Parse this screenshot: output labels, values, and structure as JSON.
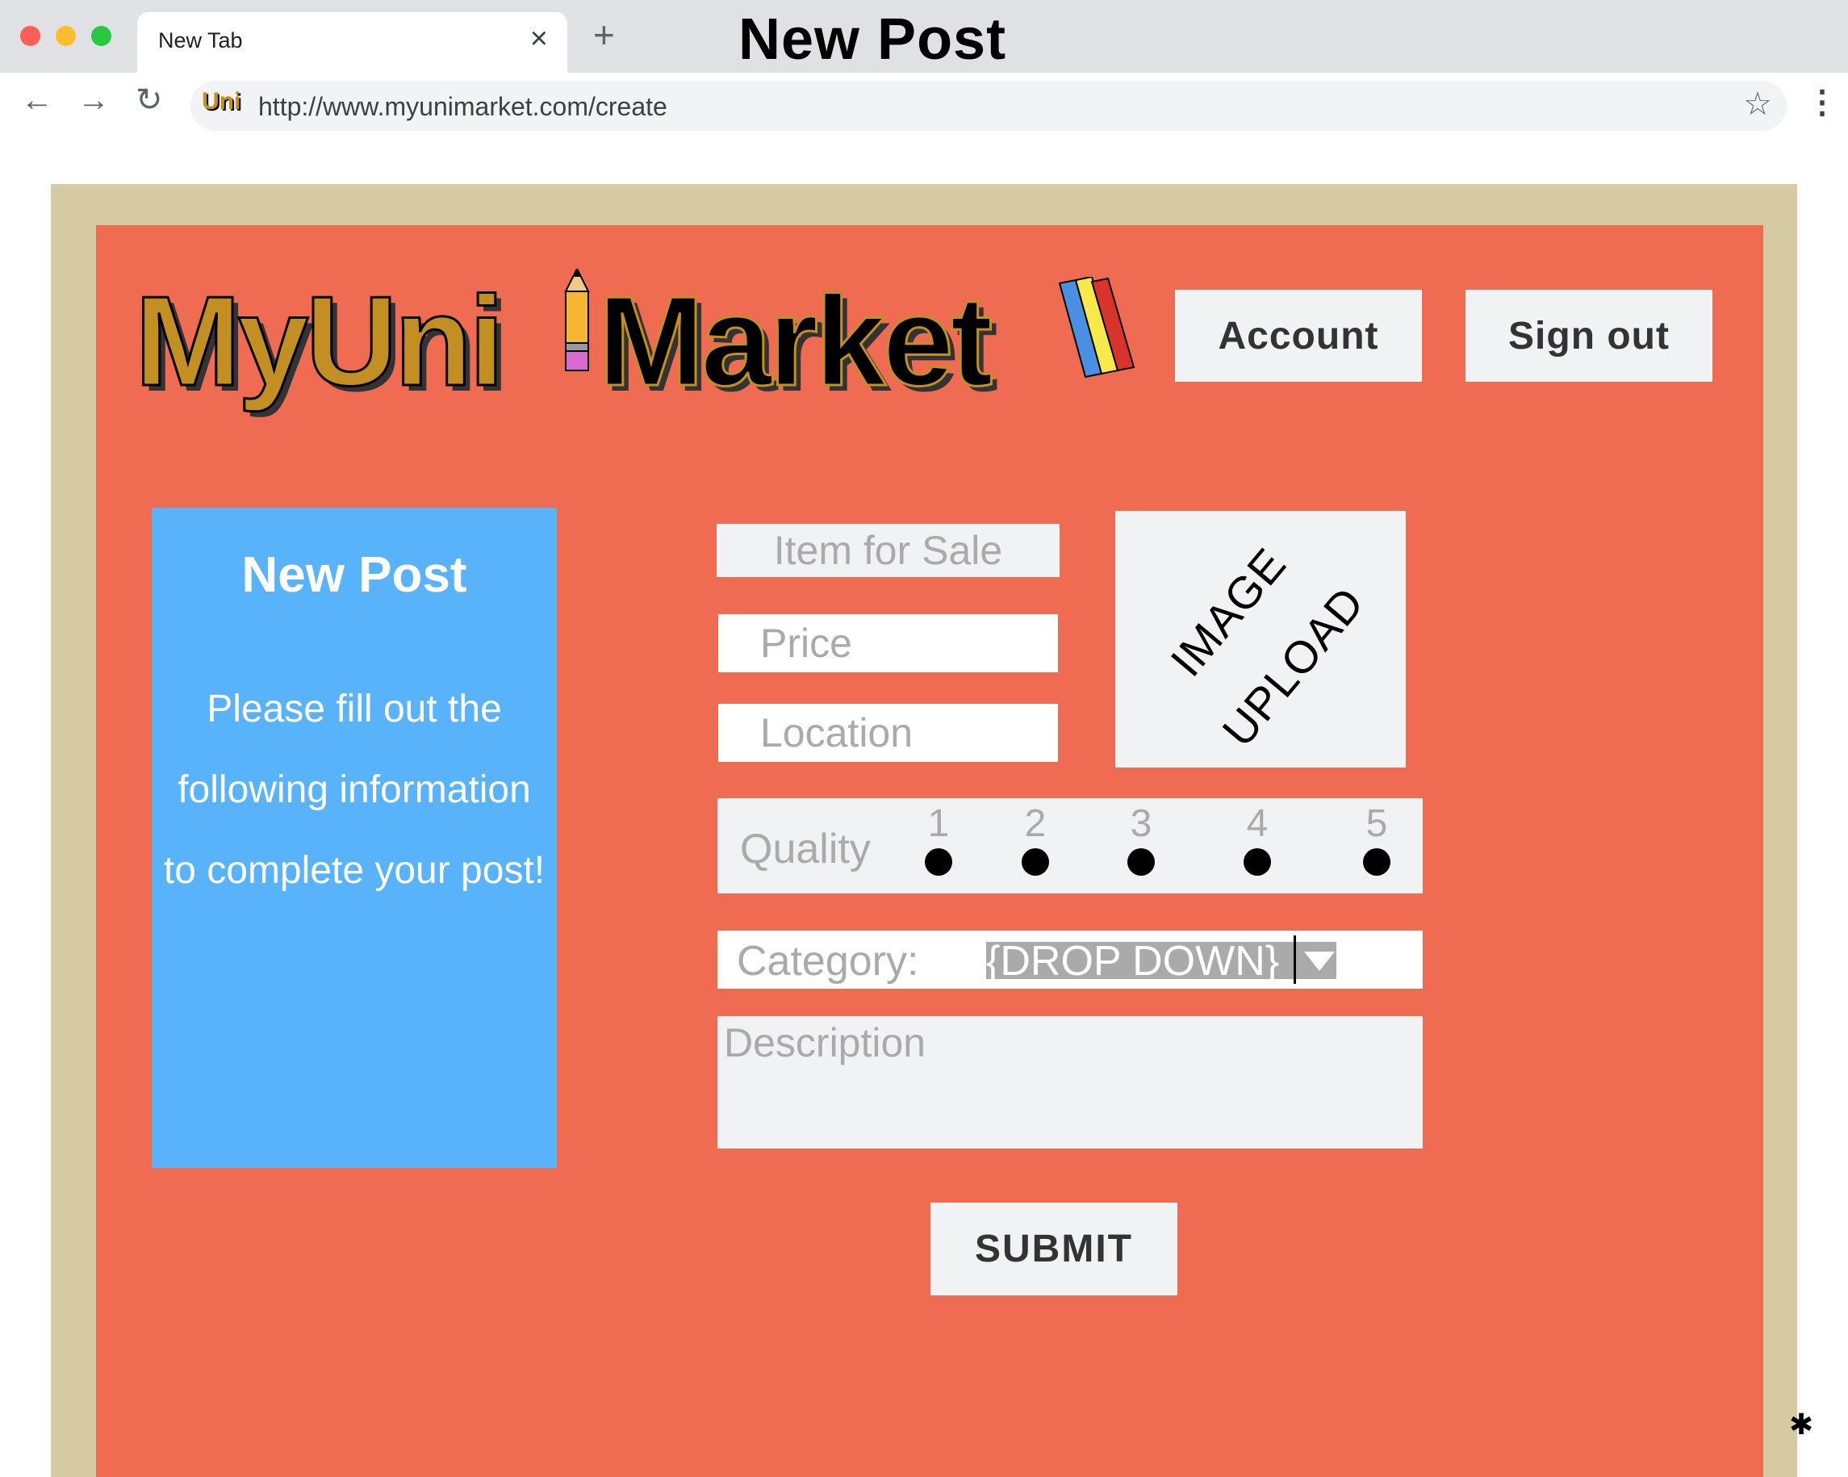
{
  "browser": {
    "tab_title": "New Tab",
    "tab_close": "×",
    "new_tab": "+",
    "window_title": "New Post",
    "url": "http://www.myunimarket.com/create",
    "site_icon_text": "Uni",
    "back": "←",
    "forward": "→",
    "reload": "↻",
    "star": "☆",
    "menu": "⋮"
  },
  "header": {
    "logo_part1": "MyUni",
    "logo_part2": "Market",
    "account_label": "Account",
    "signout_label": "Sign out"
  },
  "info_card": {
    "title": "New Post",
    "text": "Please fill out the following information to complete your post!"
  },
  "form": {
    "item_placeholder": "Item for Sale",
    "price_placeholder": "Price",
    "location_placeholder": "Location",
    "image_upload_line1": "IMAGE",
    "image_upload_line2": "UPLOAD",
    "quality_label": "Quality",
    "quality_options": [
      "1",
      "2",
      "3",
      "4",
      "5"
    ],
    "category_label": "Category:",
    "category_value": "{DROP DOWN}",
    "description_placeholder": "Description",
    "submit_label": "SUBMIT"
  },
  "colors": {
    "frame": "#d6caa3",
    "background": "#ef6b52",
    "info_card": "#58b3fa",
    "field": "#f1f2f4",
    "logo_gold": "#c48f22"
  }
}
